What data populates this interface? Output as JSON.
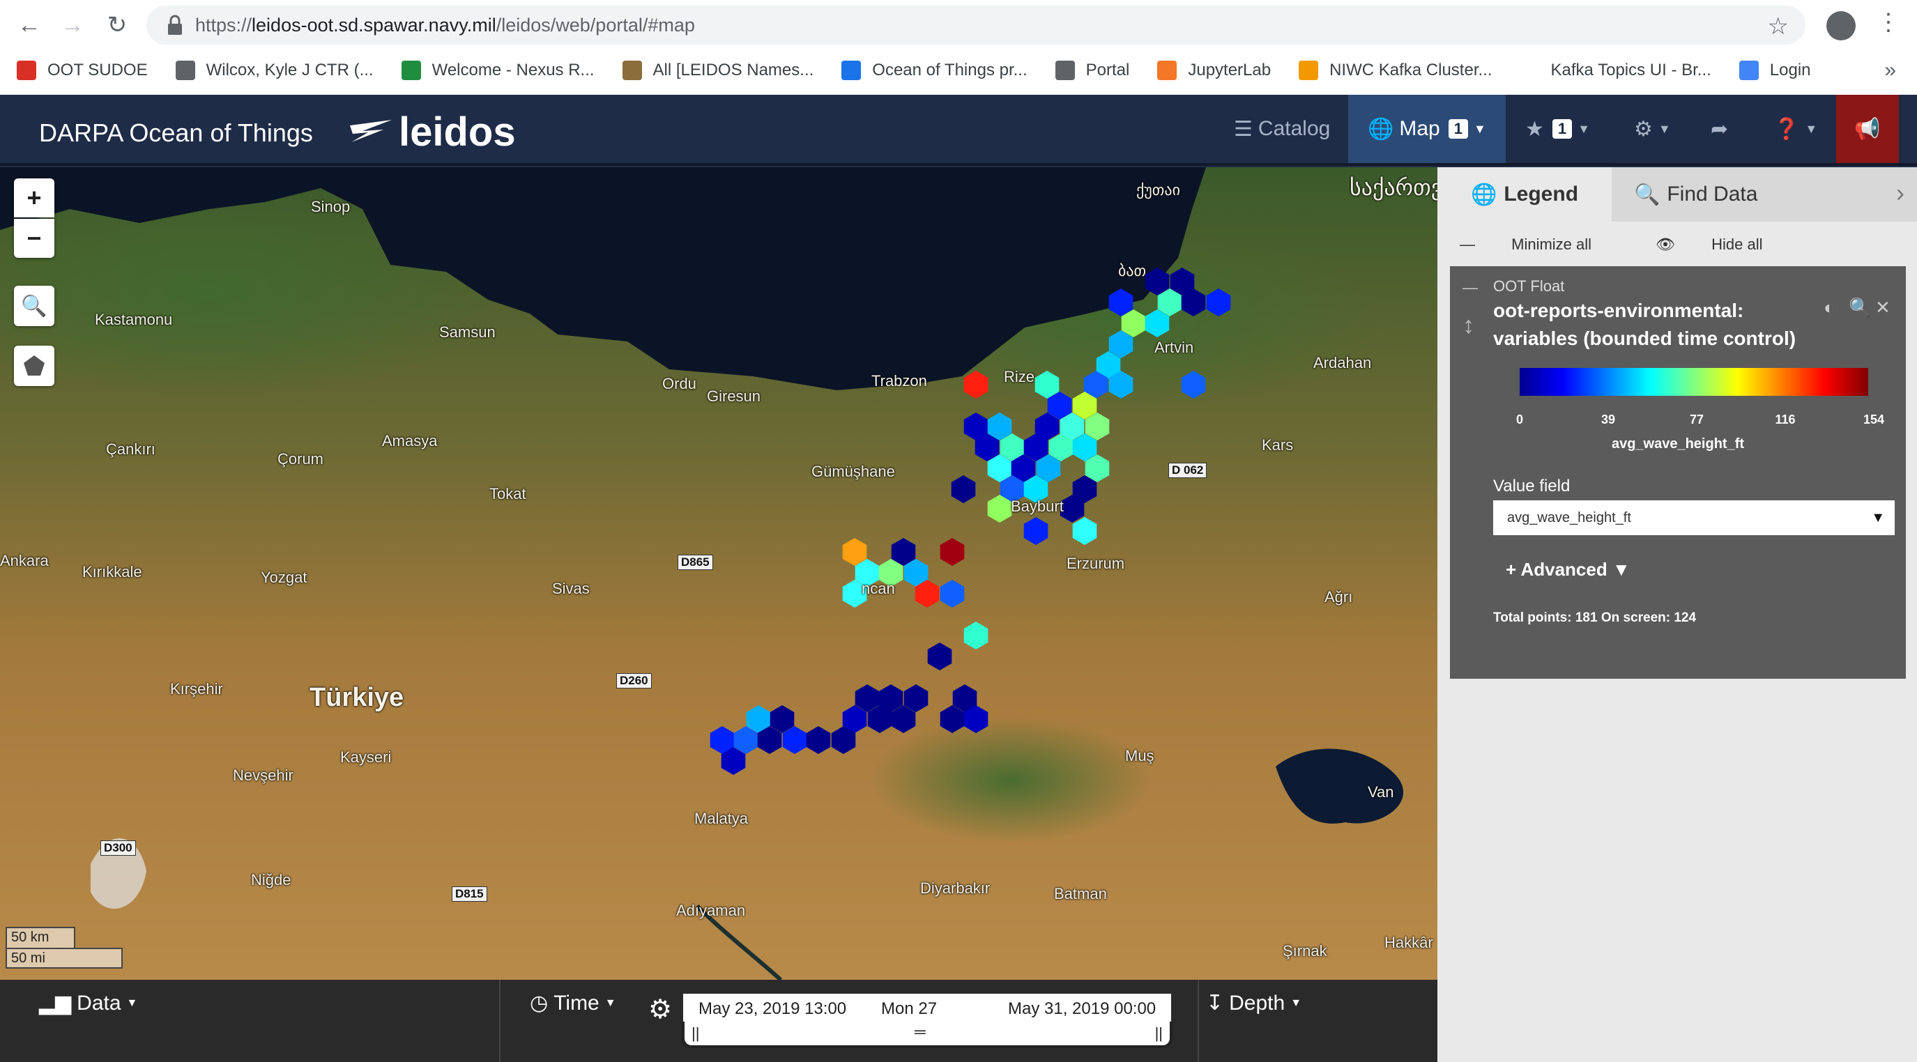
{
  "browser": {
    "url_prefix": "https://",
    "url_host": "leidos-oot.sd.spawar.navy.mil",
    "url_path": "/leidos/web/portal/#map",
    "bookmarks": [
      {
        "label": "OOT SUDOE",
        "icon": "red-shield-icon",
        "color": "#d93025"
      },
      {
        "label": "Wilcox, Kyle J CTR (...",
        "icon": "document-icon",
        "color": "#5f6368"
      },
      {
        "label": "Welcome - Nexus R...",
        "icon": "nexus-hexagon-icon",
        "color": "#1e8e3e"
      },
      {
        "label": "All [LEIDOS Names...",
        "icon": "person-icon",
        "color": "#8a6d3b"
      },
      {
        "label": "Ocean of Things pr...",
        "icon": "blue-square-icon",
        "color": "#1a73e8"
      },
      {
        "label": "Portal",
        "icon": "globe-icon",
        "color": "#5f6368"
      },
      {
        "label": "JupyterLab",
        "icon": "jupyter-icon",
        "color": "#f37726"
      },
      {
        "label": "NIWC Kafka Cluster...",
        "icon": "kafka-icon",
        "color": "#f29900"
      },
      {
        "label": "Kafka Topics UI - Br...",
        "icon": "blank-icon",
        "color": "#ffffff"
      },
      {
        "label": "Login",
        "icon": "globe-blue-icon",
        "color": "#4285f4"
      }
    ]
  },
  "header": {
    "title": "DARPA Ocean of Things",
    "brand": "leidos",
    "catalog": "Catalog",
    "map": "Map",
    "map_badge": "1",
    "star_badge": "1"
  },
  "map": {
    "places": [
      {
        "name": "Sinop",
        "cls": "place"
      },
      {
        "name": "Kastamonu",
        "cls": "place"
      },
      {
        "name": "Samsun",
        "cls": "place"
      },
      {
        "name": "Ordu",
        "cls": "place"
      },
      {
        "name": "Giresun",
        "cls": "place"
      },
      {
        "name": "Trabzon",
        "cls": "place"
      },
      {
        "name": "Rize",
        "cls": "place"
      },
      {
        "name": "Artvin",
        "cls": "place"
      },
      {
        "name": "Ardahan",
        "cls": "place"
      },
      {
        "name": "Kars",
        "cls": "place"
      },
      {
        "name": "Çankırı",
        "cls": "place"
      },
      {
        "name": "Çorum",
        "cls": "place"
      },
      {
        "name": "Amasya",
        "cls": "place"
      },
      {
        "name": "Tokat",
        "cls": "place"
      },
      {
        "name": "Gümüşhane",
        "cls": "place"
      },
      {
        "name": "Erzurum",
        "cls": "place"
      },
      {
        "name": "Ağrı",
        "cls": "place"
      },
      {
        "name": "Ankara",
        "cls": "place"
      },
      {
        "name": "Kırıkkale",
        "cls": "place"
      },
      {
        "name": "Yozgat",
        "cls": "place"
      },
      {
        "name": "Sivas",
        "cls": "place"
      },
      {
        "name": "Kırşehir",
        "cls": "place"
      },
      {
        "name": "Türkiye",
        "cls": "place place-lg"
      },
      {
        "name": "Kayseri",
        "cls": "place"
      },
      {
        "name": "Nevşehir",
        "cls": "place"
      },
      {
        "name": "Muş",
        "cls": "place"
      },
      {
        "name": "Van",
        "cls": "place"
      },
      {
        "name": "Malatya",
        "cls": "place"
      },
      {
        "name": "Niğde",
        "cls": "place"
      },
      {
        "name": "Diyarbakır",
        "cls": "place"
      },
      {
        "name": "Batman",
        "cls": "place"
      },
      {
        "name": "Adıyaman",
        "cls": "place"
      },
      {
        "name": "Şırnak",
        "cls": "place"
      },
      {
        "name": "Hakkâr",
        "cls": "place"
      },
      {
        "name": "ქუთაი",
        "cls": "place"
      },
      {
        "name": "საქართვ",
        "cls": "place place-ge"
      },
      {
        "name": "ბათ",
        "cls": "place"
      },
      {
        "name": "ncan",
        "cls": "place"
      },
      {
        "name": "Bayburt",
        "cls": "place"
      }
    ],
    "roads": [
      "D 062",
      "D865",
      "D260",
      "D300",
      "D815"
    ],
    "scale_km": "50 km",
    "scale_mi": "50 mi"
  },
  "bottom": {
    "data": "Data",
    "time": "Time",
    "depth": "Depth",
    "start": "May 23, 2019 13:00",
    "mid": "Mon 27",
    "end": "May 31, 2019 00:00"
  },
  "panel": {
    "tab_legend": "Legend",
    "tab_find": "Find Data",
    "minimize": "Minimize all",
    "hide": "Hide all",
    "group": "OOT Float",
    "title": "oot-reports-environmental: variables (bounded time control)",
    "ticks": [
      "0",
      "39",
      "77",
      "116",
      "154"
    ],
    "field_name": "avg_wave_height_ft",
    "value_field_label": "Value field",
    "value_field": "avg_wave_height_ft",
    "advanced": "Advanced",
    "total": "Total points: 181 On screen: 124"
  },
  "colors": {
    "header_bg": "#1e2c47",
    "map_active": "#2c4a76",
    "alert": "#8b1717",
    "panel_card": "#5b5b5b"
  }
}
